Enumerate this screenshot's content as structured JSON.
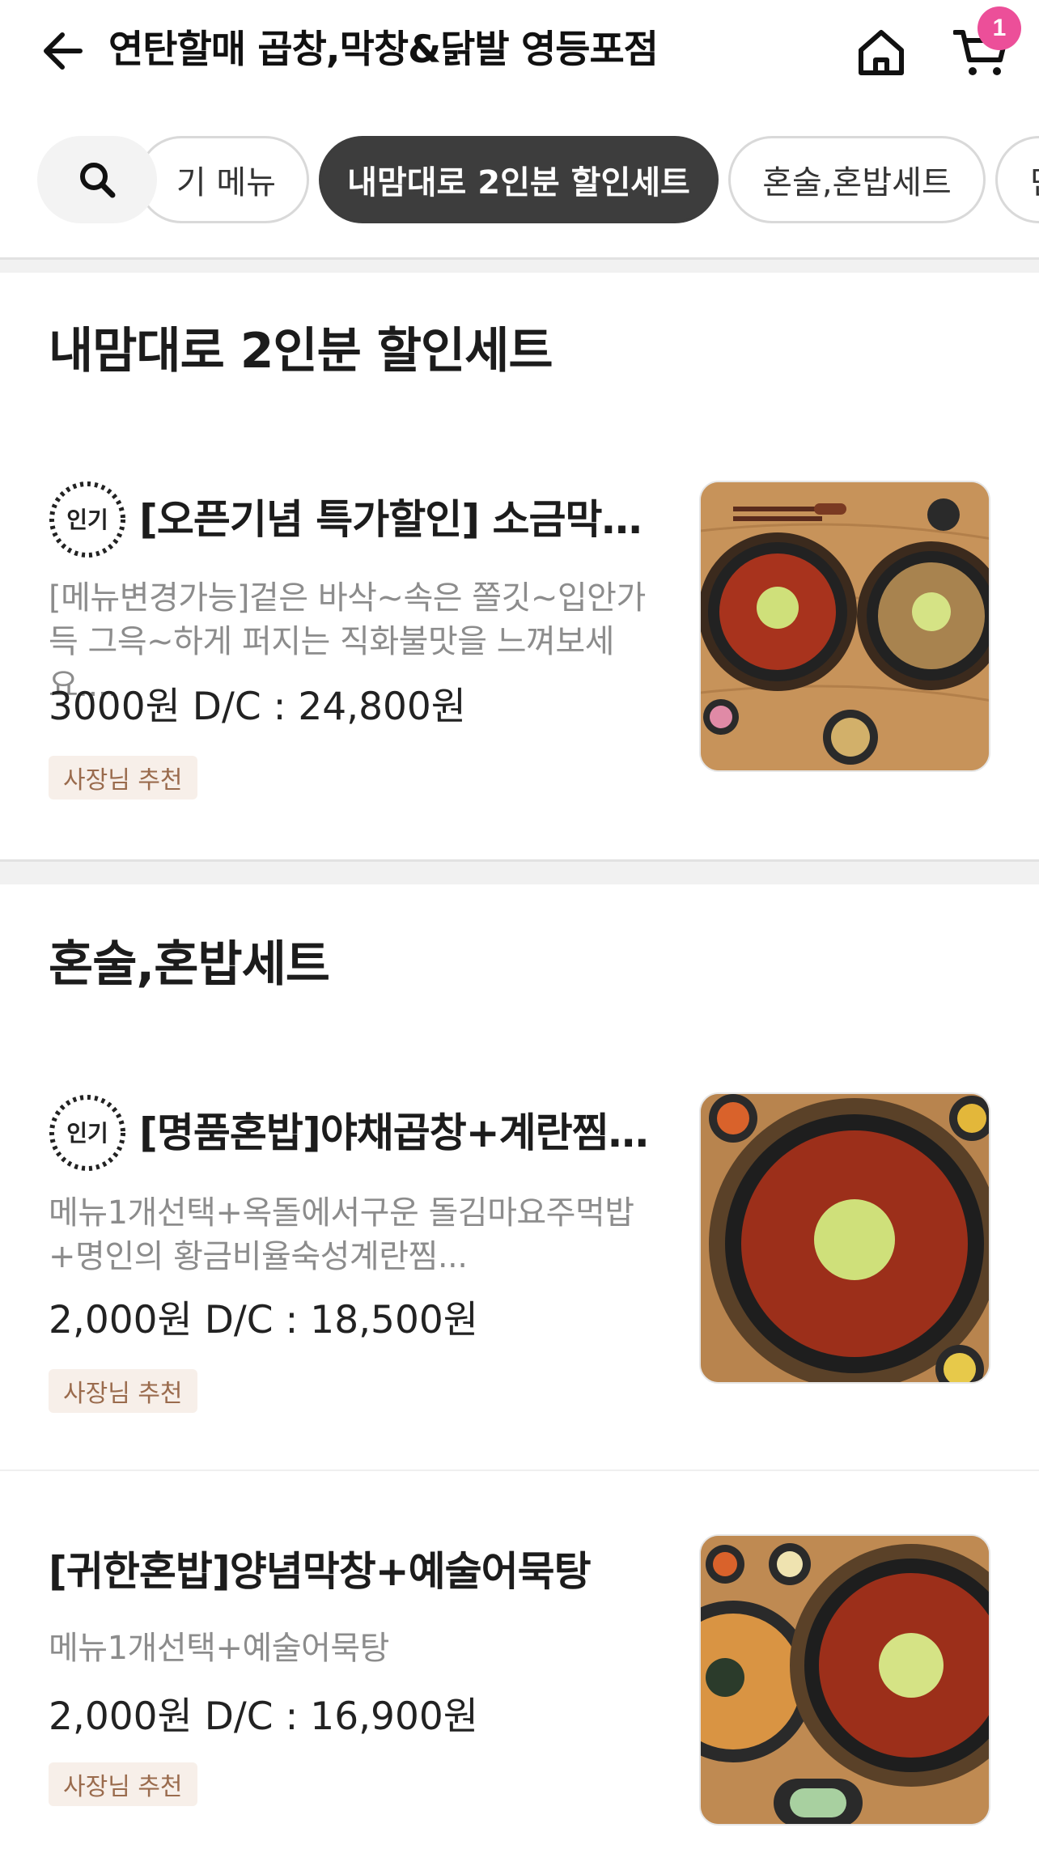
{
  "header": {
    "title": "연탄할매 곱창,막창&닭발 영등포점",
    "cart_count": "1",
    "back_icon": "arrow-left-icon",
    "home_icon": "home-icon",
    "cart_icon": "cart-icon"
  },
  "tabs": {
    "search_icon": "search-icon",
    "items": [
      {
        "label": "인기 메뉴",
        "visible_text": "기 메뉴",
        "active": false
      },
      {
        "label": "내맘대로 2인분 할인세트",
        "active": true
      },
      {
        "label": "혼술,혼밥세트",
        "active": false
      },
      {
        "label": "",
        "visible_text": "단",
        "active": false
      }
    ]
  },
  "sections": [
    {
      "title": "내맘대로 2인분 할인세트",
      "items": [
        {
          "popular": true,
          "popular_label": "인기",
          "name": "[오픈기념 특가할인] 소금막창+양념막창",
          "description": "[메뉴변경가능]겉은 바삭~속은 쫄깃~입안가득 그윽~하게 퍼지는 직화불맛을 느껴보세요....",
          "price": "3000원 D/C : 24,800원",
          "badge": "사장님 추천"
        }
      ]
    },
    {
      "title": "혼술,혼밥세트",
      "items": [
        {
          "popular": true,
          "popular_label": "인기",
          "name": "[명품혼밥]야채곱창+계란찜+돌김마요주먹밥",
          "description": "메뉴1개선택+옥돌에서구운 돌김마요주먹밥+명인의 황금비율숙성계란찜...",
          "price": "2,000원 D/C : 18,500원",
          "badge": "사장님 추천"
        },
        {
          "popular": false,
          "name": "[귀한혼밥]양념막창+예술어묵탕",
          "description": "메뉴1개선택+예술어묵탕",
          "price": "2,000원 D/C : 16,900원",
          "badge": "사장님 추천"
        }
      ]
    }
  ],
  "colors": {
    "active_tab": "#3d3d3d",
    "cart_badge": "#ec4f99",
    "recommend_badge_bg": "#f7efe9",
    "recommend_badge_text": "#9a6b4d"
  }
}
